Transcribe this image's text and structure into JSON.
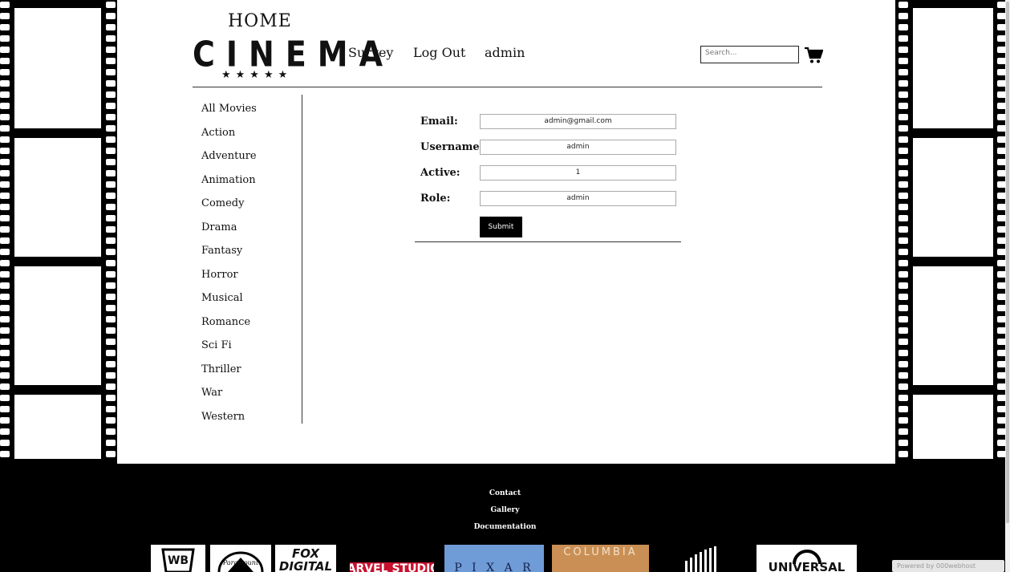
{
  "header": {
    "logo_home": "HOME",
    "logo_cinema": "CINEMA",
    "logo_stars": "★★★★★",
    "nav": [
      "Survey",
      "Log Out",
      "admin"
    ],
    "search_placeholder": "Search...",
    "cart_icon": "shopping-cart-icon"
  },
  "sidebar": {
    "categories": [
      "All Movies",
      "Action",
      "Adventure",
      "Animation",
      "Comedy",
      "Drama",
      "Fantasy",
      "Horror",
      "Musical",
      "Romance",
      "Sci Fi",
      "Thriller",
      "War",
      "Western"
    ]
  },
  "form": {
    "email_label": "Email:",
    "email_value": "admin@gmail.com",
    "username_label": "Username:",
    "username_value": "admin",
    "active_label": "Active:",
    "active_value": "1",
    "role_label": "Role:",
    "role_value": "admin",
    "submit_label": "Submit"
  },
  "footer": {
    "links": [
      "Contact",
      "Gallery",
      "Documentation"
    ],
    "brands": [
      "WB",
      "Paramount",
      "FOX DIGITAL",
      "MARVEL STUDIOS",
      "P I X A R",
      "COLUMBIA",
      "UNIVERSAL"
    ],
    "powered_by": "Powered by 000webhost"
  },
  "colors": {
    "background": "#ffffff",
    "film": "#000000",
    "footer": "#000000",
    "button": "#000000"
  }
}
